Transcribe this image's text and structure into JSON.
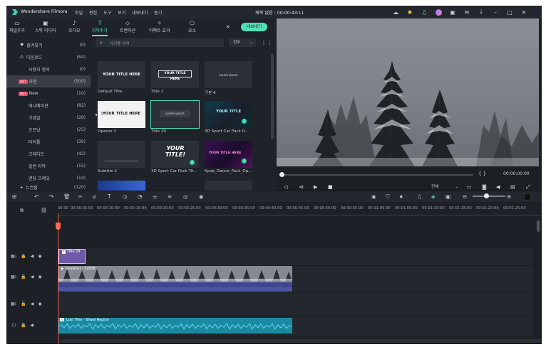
{
  "app": {
    "name": "Wondershare Filmora",
    "project_title": "제목 없음 : 00:00:43:11"
  },
  "menu": [
    "파일",
    "편집",
    "도구",
    "보기",
    "내보내기",
    "돕기"
  ],
  "window_icons": [
    "cloud-icon",
    "bulb-icon",
    "headset-icon",
    "avatar-icon",
    "save-icon",
    "mail-icon",
    "download-icon",
    "minimize-icon",
    "maximize-icon",
    "close-icon"
  ],
  "tabs": [
    {
      "label": "파일추가",
      "icon": "▭"
    },
    {
      "label": "스톡 미디어",
      "icon": "▣"
    },
    {
      "label": "오디오",
      "icon": "♪"
    },
    {
      "label": "자막추가",
      "icon": "T",
      "active": true
    },
    {
      "label": "트랜지션",
      "icon": "⬦"
    },
    {
      "label": "이펙트 효과",
      "icon": "✧"
    },
    {
      "label": "요소",
      "icon": "⬠"
    }
  ],
  "export_label": "내보내기",
  "more_icon": "»",
  "sidebar": [
    {
      "label": "즐겨찾기",
      "count": "(0)",
      "icon": "♥"
    },
    {
      "label": "다운로드",
      "count": "(64)",
      "icon": "⊙"
    },
    {
      "label": "사용자 정의",
      "count": "(0)"
    },
    {
      "label": "추천",
      "count": "(500)",
      "hot": "HOT",
      "selected": true
    },
    {
      "label": "New",
      "count": "(10)",
      "hot": "HOT"
    },
    {
      "label": "애니메이션",
      "count": "(82)"
    },
    {
      "label": "기념일",
      "count": "(28)"
    },
    {
      "label": "오프닝",
      "count": "(25)"
    },
    {
      "label": "타이틀",
      "count": "(39)"
    },
    {
      "label": "크레디트",
      "count": "(42)"
    },
    {
      "label": "일반 자막",
      "count": "(15)"
    },
    {
      "label": "엔딩 크레딧",
      "count": "(14)"
    },
    {
      "label": "뉴컨셉",
      "count": "(120)"
    }
  ],
  "library": {
    "search_placeholder": "타이틀 검색",
    "filter_value": "전부",
    "thumbs": [
      {
        "label": "Default Title",
        "text": "YOUR TITLE HERE"
      },
      {
        "label": "Title 2",
        "text": "YOUR TITLE HERE"
      },
      {
        "label": "기본 6",
        "text": "Lorem ipsum"
      },
      {
        "label": "Opener 1",
        "text": "|YOUR TITLE HERE"
      },
      {
        "label": "Title 29",
        "text": "Lorem ipsum",
        "selected": true
      },
      {
        "label": "3D Sport Car Pack O...",
        "text": "YOUR TITLE"
      },
      {
        "label": "Subtitle 2",
        "text": ""
      },
      {
        "label": "3D Sport Car Pack Tit...",
        "text": "YOUR TITLE!"
      },
      {
        "label": "Kpop_Dance_Pack_Op...",
        "text": "YOUR TITLE HERE"
      }
    ]
  },
  "preview": {
    "timecode": "00:00:00:00",
    "braces": "{      }",
    "quality": "전체"
  },
  "ruler_ticks": [
    "00:00",
    "00:00:05:00",
    "00:00:10:00",
    "00:00:15:00",
    "00:00:20:00",
    "00:00:25:00",
    "00:00:30:00",
    "00:00:35:00",
    "00:00:40:00",
    "00:00:45:00",
    "00:00:50:00",
    "00:00:55:00",
    "00:01:00:00",
    "00:01:05:00",
    "00:01:10:00",
    "00:01:15:00",
    "00:01:20:00",
    "00:01:25:00"
  ],
  "tracks": [
    {
      "num": "3",
      "type": "video"
    },
    {
      "num": "2",
      "type": "video"
    },
    {
      "num": "1",
      "type": "video"
    },
    {
      "num": "1",
      "type": "audio"
    }
  ],
  "clips": {
    "title_clip": "Title 29",
    "video_clip": "Snowfall - 32858",
    "audio_clip": "Lost Tree - Shaal Region"
  },
  "colors": {
    "accent": "#4ee0b9",
    "playhead": "#ff6a4d",
    "title_clip": "#6f5aa8",
    "video_clip": "#4b55a0",
    "audio_clip": "#1a8aa3"
  }
}
